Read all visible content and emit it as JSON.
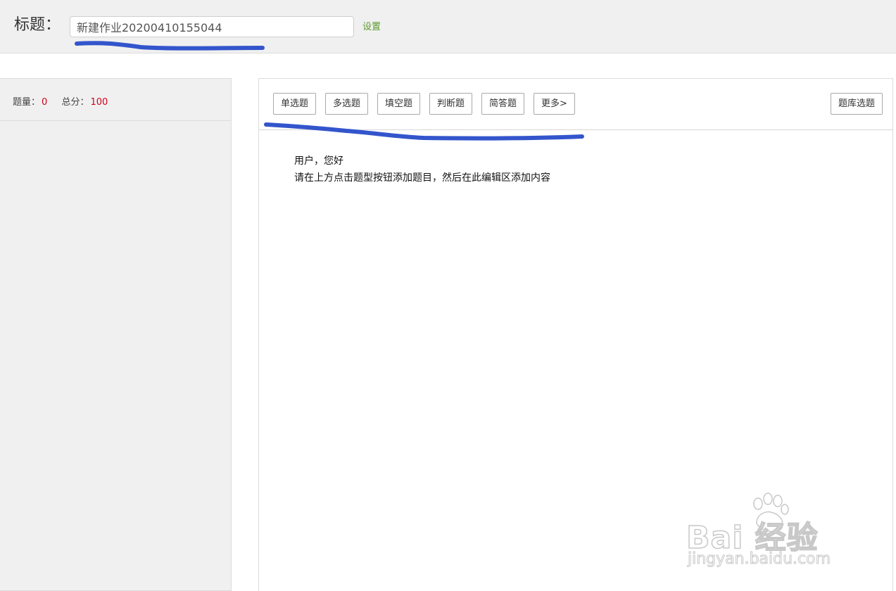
{
  "header": {
    "title_label": "标题：",
    "title_value": "新建作业20200410155044",
    "settings_link": "设置"
  },
  "sidebar": {
    "count_label": "题量：",
    "count_value": "0",
    "score_label": "总分：",
    "score_value": "100"
  },
  "toolbar": {
    "buttons": [
      {
        "label": "单选题"
      },
      {
        "label": "多选题"
      },
      {
        "label": "填空题"
      },
      {
        "label": "判断题"
      },
      {
        "label": "简答题"
      },
      {
        "label": "更多>"
      }
    ],
    "bank_button": "题库选题"
  },
  "editor": {
    "greeting": "用户，您好",
    "instruction": "请在上方点击题型按钮添加题目，然后在此编辑区添加内容"
  },
  "watermark": {
    "brand": "Bai 经验",
    "url": "jingyan.baidu.com"
  },
  "colors": {
    "annotation_stroke": "#3355cc",
    "settings_link": "#5a9a2b",
    "stat_value": "#d0021b"
  }
}
